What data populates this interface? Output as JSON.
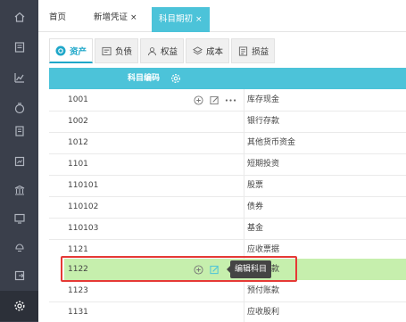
{
  "sidebar": {
    "items": [
      {
        "icon": "home-icon"
      },
      {
        "icon": "voucher-icon"
      },
      {
        "icon": "chart-icon"
      },
      {
        "icon": "wallet-icon"
      },
      {
        "icon": "document-icon"
      },
      {
        "icon": "report-icon"
      },
      {
        "icon": "bank-icon"
      },
      {
        "icon": "monitor-icon"
      },
      {
        "icon": "hand-icon"
      },
      {
        "icon": "export-icon"
      },
      {
        "icon": "gear-icon"
      }
    ],
    "active_index": 10
  },
  "tabs": [
    {
      "label": "首页",
      "closable": false
    },
    {
      "label": "新增凭证",
      "closable": true
    },
    {
      "label": "科目期初",
      "closable": true,
      "active": true
    }
  ],
  "close_glyph": "×",
  "category_tabs": [
    {
      "label": "资产",
      "icon": "asset-icon"
    },
    {
      "label": "负债",
      "icon": "liability-icon"
    },
    {
      "label": "权益",
      "icon": "equity-icon"
    },
    {
      "label": "成本",
      "icon": "cost-icon"
    },
    {
      "label": "损益",
      "icon": "profit-loss-icon"
    }
  ],
  "table": {
    "header_label": "科目编码",
    "rows": [
      {
        "code": "1001",
        "name": "库存现金"
      },
      {
        "code": "1002",
        "name": "银行存款"
      },
      {
        "code": "1012",
        "name": "其他货币资金"
      },
      {
        "code": "1101",
        "name": "短期投资"
      },
      {
        "code": "110101",
        "name": "股票"
      },
      {
        "code": "110102",
        "name": "债券"
      },
      {
        "code": "110103",
        "name": "基金"
      },
      {
        "code": "1121",
        "name": "应收票据"
      },
      {
        "code": "1122",
        "name": "应收账款"
      },
      {
        "code": "1123",
        "name": "预付账款"
      },
      {
        "code": "1131",
        "name": "应收股利"
      }
    ]
  },
  "tooltip_text": "编辑科目",
  "colors": {
    "accent": "#4cc3d9",
    "highlight_row": "#c6efad",
    "sidebar": "#3a3f4b",
    "annotation": "#e53935"
  }
}
